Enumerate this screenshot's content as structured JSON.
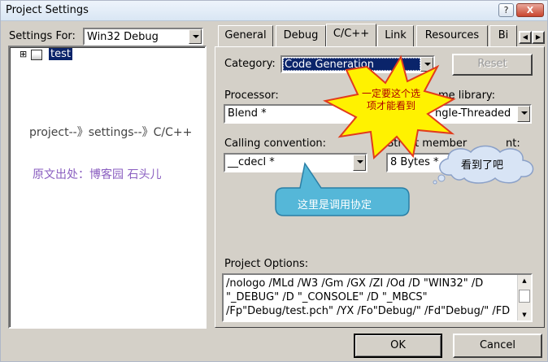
{
  "window": {
    "title": "Project Settings",
    "help_btn": "?",
    "close_btn": "X"
  },
  "left": {
    "settings_for_label": "Settings For:",
    "settings_for_value": "Win32 Debug",
    "tree_expander": "⊞",
    "tree_item": "test",
    "annotation_path": "project--》settings--》C/C++",
    "annotation_source": "原文出处：博客园 石头儿"
  },
  "tabs": [
    "General",
    "Debug",
    "C/C++",
    "Link",
    "Resources",
    "Bi"
  ],
  "tab_nav": {
    "prev": "◀",
    "next": "▶"
  },
  "form": {
    "category_label": "Category:",
    "category_value": "Code Generation",
    "reset_label": "Reset",
    "processor_label": "Processor:",
    "processor_value": "Blend *",
    "runtime_label": "me library:",
    "runtime_value": "ngle-Threaded",
    "calling_label": "Calling convention:",
    "calling_value": "__cdecl *",
    "struct_label": "Struct member",
    "struct_label_tail": "nt:",
    "struct_value": "8 Bytes *",
    "options_label": "Project Options:",
    "options_lines": [
      "/nologo /MLd /W3 /Gm /GX /ZI /Od /D \"WIN32\" /D",
      "\"_DEBUG\" /D \"_CONSOLE\" /D \"_MBCS\"",
      "/Fp\"Debug/test.pch\" /YX /Fo\"Debug/\" /Fd\"Debug/\" /FD"
    ]
  },
  "callouts": {
    "star": "一定要这个选\n项才能看到",
    "cloud": "看到了吧",
    "arrow": "这里是调用协定"
  },
  "buttons": {
    "ok": "OK",
    "cancel": "Cancel"
  }
}
